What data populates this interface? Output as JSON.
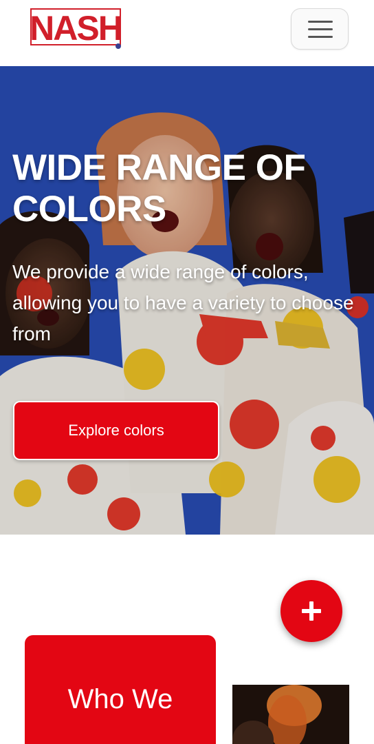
{
  "header": {
    "logo_text": "NASH",
    "menu_icon": "hamburger-menu-icon"
  },
  "hero": {
    "title": "WIDE RANGE OF COLORS",
    "description": "We provide a wide range of colors, allowing you to have a variety to choose from",
    "cta_label": "Explore colors"
  },
  "section": {
    "fab_icon": "plus-icon",
    "card_title": "Who We"
  },
  "colors": {
    "brand_red": "#e30613",
    "hero_blue": "#2f56c5",
    "paint_yellow": "#f2c21b"
  }
}
